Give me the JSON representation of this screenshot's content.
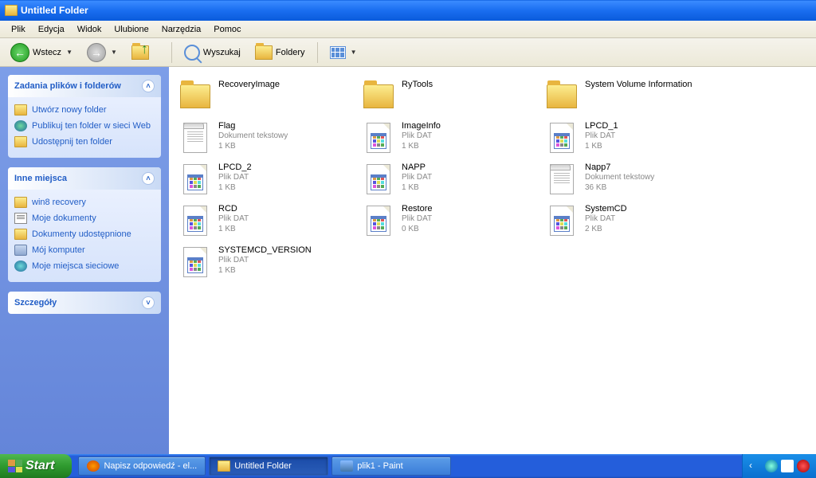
{
  "window": {
    "title": "Untitled Folder"
  },
  "menu": {
    "file": "Plik",
    "edit": "Edycja",
    "view": "Widok",
    "favorites": "Ulubione",
    "tools": "Narzędzia",
    "help": "Pomoc"
  },
  "toolbar": {
    "back": "Wstecz",
    "search": "Wyszukaj",
    "folders": "Foldery"
  },
  "sidebar": {
    "tasks": {
      "title": "Zadania plików i folderów",
      "new_folder": "Utwórz nowy folder",
      "publish": "Publikuj ten folder w sieci Web",
      "share": "Udostępnij ten folder"
    },
    "places": {
      "title": "Inne miejsca",
      "items": [
        {
          "label": "win8 recovery",
          "icon": "folder"
        },
        {
          "label": "Moje dokumenty",
          "icon": "doc"
        },
        {
          "label": "Dokumenty udostępnione",
          "icon": "folder"
        },
        {
          "label": "Mój komputer",
          "icon": "computer"
        },
        {
          "label": "Moje miejsca sieciowe",
          "icon": "net"
        }
      ]
    },
    "details": {
      "title": "Szczegóły"
    }
  },
  "files": [
    {
      "name": "RecoveryImage",
      "type": "folder"
    },
    {
      "name": "RyTools",
      "type": "folder"
    },
    {
      "name": "System Volume Information",
      "type": "folder"
    },
    {
      "name": "Flag",
      "type": "txt",
      "kind": "Dokument tekstowy",
      "size": "1 KB"
    },
    {
      "name": "ImageInfo",
      "type": "dat",
      "kind": "Plik DAT",
      "size": "1 KB"
    },
    {
      "name": "LPCD_1",
      "type": "dat",
      "kind": "Plik DAT",
      "size": "1 KB"
    },
    {
      "name": "LPCD_2",
      "type": "dat",
      "kind": "Plik DAT",
      "size": "1 KB"
    },
    {
      "name": "NAPP",
      "type": "dat",
      "kind": "Plik DAT",
      "size": "1 KB"
    },
    {
      "name": "Napp7",
      "type": "txt",
      "kind": "Dokument tekstowy",
      "size": "36 KB"
    },
    {
      "name": "RCD",
      "type": "dat",
      "kind": "Plik DAT",
      "size": "1 KB"
    },
    {
      "name": "Restore",
      "type": "dat",
      "kind": "Plik DAT",
      "size": "0 KB"
    },
    {
      "name": "SystemCD",
      "type": "dat",
      "kind": "Plik DAT",
      "size": "2 KB"
    },
    {
      "name": "SYSTEMCD_VERSION",
      "type": "dat",
      "kind": "Plik DAT",
      "size": "1 KB"
    }
  ],
  "taskbar": {
    "start": "Start",
    "tasks": [
      {
        "label": "Napisz odpowiedź - el...",
        "icon": "firefox"
      },
      {
        "label": "Untitled Folder",
        "icon": "folder",
        "active": true
      },
      {
        "label": "plik1 - Paint",
        "icon": "paint"
      }
    ]
  }
}
